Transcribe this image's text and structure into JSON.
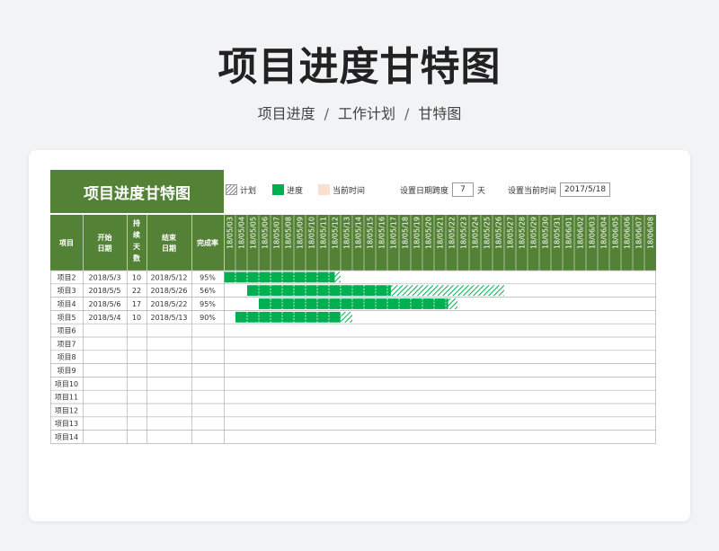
{
  "page": {
    "title": "项目进度甘特图",
    "breadcrumb": [
      "项目进度",
      "工作计划",
      "甘特图"
    ],
    "breadcrumb_sep": "/"
  },
  "sheet": {
    "title": "项目进度甘特图",
    "legend": {
      "plan": "计划",
      "progress": "进度",
      "today": "当前时间"
    },
    "controls": {
      "span_label": "设置日期跨度",
      "span_value": "7",
      "span_unit": "天",
      "current_label": "设置当前时间",
      "current_value": "2017/5/18"
    },
    "headers": {
      "project": "项目",
      "start": [
        "开始",
        "日期"
      ],
      "duration": [
        "持",
        "续",
        "天",
        "数"
      ],
      "end": [
        "结束",
        "日期"
      ],
      "completion": "完成率"
    },
    "dates": [
      "18/05/03",
      "18/05/04",
      "18/05/05",
      "18/05/06",
      "18/05/07",
      "18/05/08",
      "18/05/09",
      "18/05/10",
      "18/05/11",
      "18/05/12",
      "18/05/13",
      "18/05/14",
      "18/05/15",
      "18/05/16",
      "18/05/17",
      "18/05/18",
      "18/05/19",
      "18/05/20",
      "18/05/21",
      "18/05/22",
      "18/05/23",
      "18/05/24",
      "18/05/25",
      "18/05/26",
      "18/05/27",
      "18/05/28",
      "18/05/29",
      "18/05/30",
      "18/05/31",
      "18/06/01",
      "18/06/02",
      "18/06/03",
      "18/06/04",
      "18/06/05",
      "18/06/06",
      "18/06/07",
      "18/06/08"
    ],
    "rows": [
      {
        "name": "项目2",
        "start": "2018/5/3",
        "duration": "10",
        "end": "2018/5/12",
        "completion": "95%",
        "plan_start": 0,
        "plan_days": 10,
        "progress_days": 9.5
      },
      {
        "name": "项目3",
        "start": "2018/5/5",
        "duration": "22",
        "end": "2018/5/26",
        "completion": "56%",
        "plan_start": 2,
        "plan_days": 22,
        "progress_days": 12.3
      },
      {
        "name": "项目4",
        "start": "2018/5/6",
        "duration": "17",
        "end": "2018/5/22",
        "completion": "95%",
        "plan_start": 3,
        "plan_days": 17,
        "progress_days": 16.2
      },
      {
        "name": "项目5",
        "start": "2018/5/4",
        "duration": "10",
        "end": "2018/5/13",
        "completion": "90%",
        "plan_start": 1,
        "plan_days": 10,
        "progress_days": 9
      },
      {
        "name": "项目6"
      },
      {
        "name": "项目7"
      },
      {
        "name": "项目8"
      },
      {
        "name": "项目9"
      },
      {
        "name": "项目10"
      },
      {
        "name": "项目11"
      },
      {
        "name": "项目12"
      },
      {
        "name": "项目13"
      },
      {
        "name": "项目14"
      }
    ]
  },
  "colors": {
    "header_bg": "#538135",
    "header_text": "#ffffff",
    "progress": "#00b050",
    "plan_hatch": "#00b050",
    "today": "#fbe0d0",
    "grid": "#b0b0b0"
  }
}
